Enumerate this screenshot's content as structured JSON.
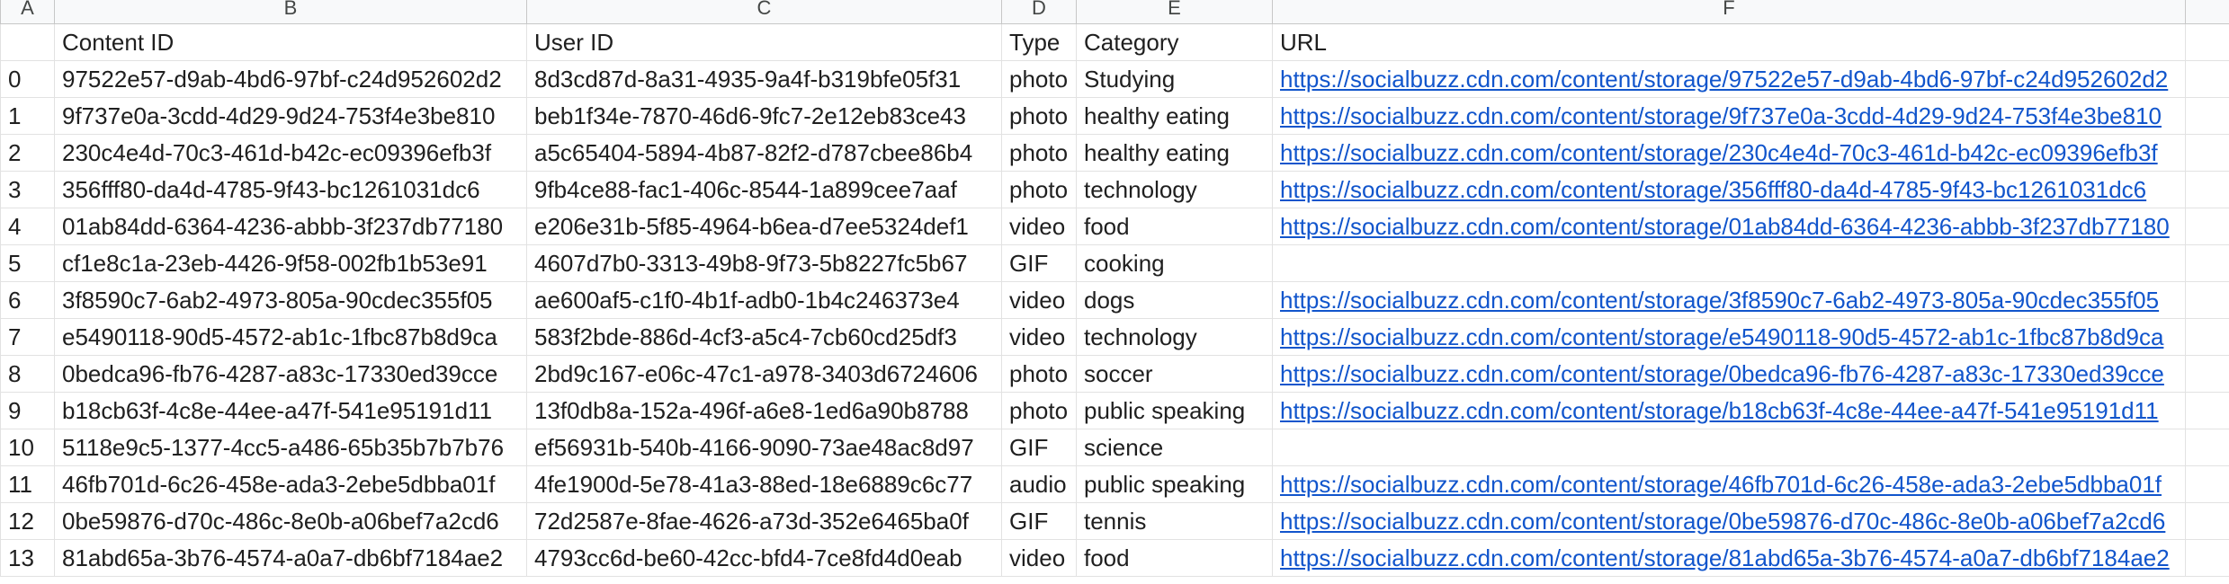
{
  "column_letters": [
    "A",
    "B",
    "C",
    "D",
    "E",
    "F",
    ""
  ],
  "headers": {
    "index": "",
    "content_id": "Content ID",
    "user_id": "User ID",
    "type": "Type",
    "category": "Category",
    "url": "URL"
  },
  "rows": [
    {
      "index": "0",
      "content_id": "97522e57-d9ab-4bd6-97bf-c24d952602d2",
      "user_id": "8d3cd87d-8a31-4935-9a4f-b319bfe05f31",
      "type": "photo",
      "category": "Studying",
      "url": "https://socialbuzz.cdn.com/content/storage/97522e57-d9ab-4bd6-97bf-c24d952602d2"
    },
    {
      "index": "1",
      "content_id": "9f737e0a-3cdd-4d29-9d24-753f4e3be810",
      "user_id": "beb1f34e-7870-46d6-9fc7-2e12eb83ce43",
      "type": "photo",
      "category": "healthy eating",
      "url": "https://socialbuzz.cdn.com/content/storage/9f737e0a-3cdd-4d29-9d24-753f4e3be810"
    },
    {
      "index": "2",
      "content_id": "230c4e4d-70c3-461d-b42c-ec09396efb3f",
      "user_id": "a5c65404-5894-4b87-82f2-d787cbee86b4",
      "type": "photo",
      "category": "healthy eating",
      "url": "https://socialbuzz.cdn.com/content/storage/230c4e4d-70c3-461d-b42c-ec09396efb3f"
    },
    {
      "index": "3",
      "content_id": "356fff80-da4d-4785-9f43-bc1261031dc6",
      "user_id": "9fb4ce88-fac1-406c-8544-1a899cee7aaf",
      "type": "photo",
      "category": "technology",
      "url": "https://socialbuzz.cdn.com/content/storage/356fff80-da4d-4785-9f43-bc1261031dc6"
    },
    {
      "index": "4",
      "content_id": "01ab84dd-6364-4236-abbb-3f237db77180",
      "user_id": "e206e31b-5f85-4964-b6ea-d7ee5324def1",
      "type": "video",
      "category": "food",
      "url": "https://socialbuzz.cdn.com/content/storage/01ab84dd-6364-4236-abbb-3f237db77180"
    },
    {
      "index": "5",
      "content_id": "cf1e8c1a-23eb-4426-9f58-002fb1b53e91",
      "user_id": "4607d7b0-3313-49b8-9f73-5b8227fc5b67",
      "type": "GIF",
      "category": "cooking",
      "url": ""
    },
    {
      "index": "6",
      "content_id": "3f8590c7-6ab2-4973-805a-90cdec355f05",
      "user_id": "ae600af5-c1f0-4b1f-adb0-1b4c246373e4",
      "type": "video",
      "category": "dogs",
      "url": "https://socialbuzz.cdn.com/content/storage/3f8590c7-6ab2-4973-805a-90cdec355f05"
    },
    {
      "index": "7",
      "content_id": "e5490118-90d5-4572-ab1c-1fbc87b8d9ca",
      "user_id": "583f2bde-886d-4cf3-a5c4-7cb60cd25df3",
      "type": "video",
      "category": "technology",
      "url": "https://socialbuzz.cdn.com/content/storage/e5490118-90d5-4572-ab1c-1fbc87b8d9ca"
    },
    {
      "index": "8",
      "content_id": "0bedca96-fb76-4287-a83c-17330ed39cce",
      "user_id": "2bd9c167-e06c-47c1-a978-3403d6724606",
      "type": "photo",
      "category": "soccer",
      "url": "https://socialbuzz.cdn.com/content/storage/0bedca96-fb76-4287-a83c-17330ed39cce"
    },
    {
      "index": "9",
      "content_id": "b18cb63f-4c8e-44ee-a47f-541e95191d11",
      "user_id": "13f0db8a-152a-496f-a6e8-1ed6a90b8788",
      "type": "photo",
      "category": "public speaking",
      "url": "https://socialbuzz.cdn.com/content/storage/b18cb63f-4c8e-44ee-a47f-541e95191d11"
    },
    {
      "index": "10",
      "content_id": "5118e9c5-1377-4cc5-a486-65b35b7b7b76",
      "user_id": "ef56931b-540b-4166-9090-73ae48ac8d97",
      "type": "GIF",
      "category": "science",
      "url": ""
    },
    {
      "index": "11",
      "content_id": "46fb701d-6c26-458e-ada3-2ebe5dbba01f",
      "user_id": "4fe1900d-5e78-41a3-88ed-18e6889c6c77",
      "type": "audio",
      "category": "public speaking",
      "url": "https://socialbuzz.cdn.com/content/storage/46fb701d-6c26-458e-ada3-2ebe5dbba01f"
    },
    {
      "index": "12",
      "content_id": "0be59876-d70c-486c-8e0b-a06bef7a2cd6",
      "user_id": "72d2587e-8fae-4626-a73d-352e6465ba0f",
      "type": "GIF",
      "category": "tennis",
      "url": "https://socialbuzz.cdn.com/content/storage/0be59876-d70c-486c-8e0b-a06bef7a2cd6"
    },
    {
      "index": "13",
      "content_id": "81abd65a-3b76-4574-a0a7-db6bf7184ae2",
      "user_id": "4793cc6d-be60-42cc-bfd4-7ce8fd4d0eab",
      "type": "video",
      "category": "food",
      "url": "https://socialbuzz.cdn.com/content/storage/81abd65a-3b76-4574-a0a7-db6bf7184ae2"
    }
  ],
  "colors": {
    "link": "#1155cc",
    "gridline": "#e2e2e2",
    "column_header_bg": "#f8f9fa"
  }
}
